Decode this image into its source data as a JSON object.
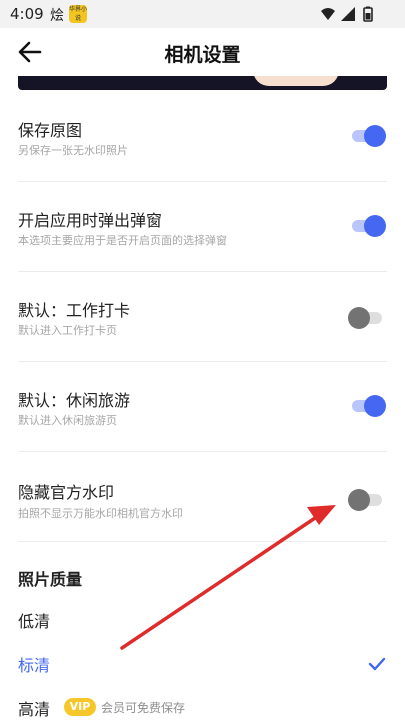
{
  "status_bar": {
    "time": "4:09",
    "notification_glyph": "烩",
    "app_icon_text": "华界小说",
    "icons": [
      "wifi-icon",
      "signal-icon",
      "battery-icon"
    ]
  },
  "header": {
    "title": "相机设置",
    "back_icon": "arrow-left-icon"
  },
  "settings": [
    {
      "title": "保存原图",
      "subtitle": "另保存一张无水印照片",
      "enabled": true
    },
    {
      "title": "开启应用时弹出弹窗",
      "subtitle": "本选项主要应用于是否开启页面的选择弹窗",
      "enabled": true
    },
    {
      "title": "默认：工作打卡",
      "subtitle": "默认进入工作打卡页",
      "enabled": false
    },
    {
      "title": "默认：休闲旅游",
      "subtitle": "默认进入休闲旅游页",
      "enabled": true
    },
    {
      "title": "隐藏官方水印",
      "subtitle": "拍照不显示万能水印相机官方水印",
      "enabled": false
    }
  ],
  "photo_quality": {
    "title": "照片质量",
    "options": [
      {
        "label": "低清",
        "selected": false
      },
      {
        "label": "标清",
        "selected": true
      },
      {
        "label": "高清",
        "selected": false,
        "badge": "VIP",
        "note": "会员可免费保存"
      }
    ]
  },
  "colors": {
    "accent": "#4568f2",
    "toggle_on_track": "#b9c5fb",
    "toggle_off_knob": "#737373",
    "annotation_arrow": "#e02b2b",
    "vip": "#f7c72a"
  }
}
